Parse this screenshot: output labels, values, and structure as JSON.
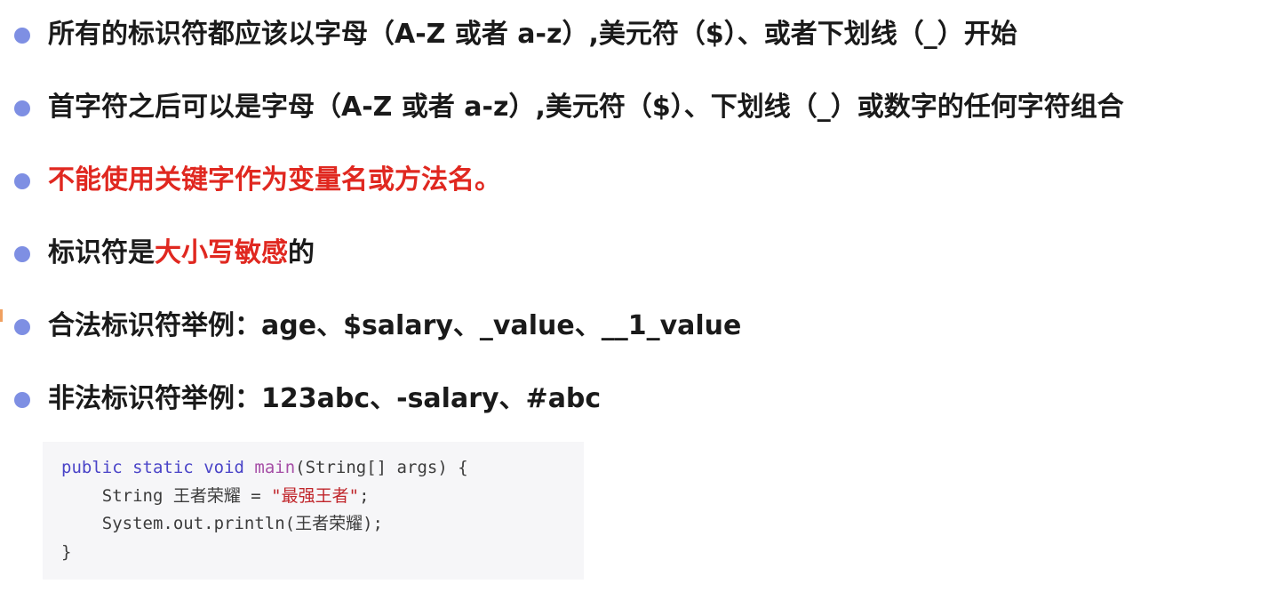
{
  "bullets": [
    {
      "text": "所有的标识符都应该以字母（A-Z 或者 a-z）,美元符（$）、或者下划线（_）开始"
    },
    {
      "text": "首字符之后可以是字母（A-Z 或者 a-z）,美元符（$）、下划线（_）或数字的任何字符组合"
    },
    {
      "text": "不能使用关键字作为变量名或方法名。"
    },
    {
      "prefix": "标识符是",
      "highlight": "大小写敏感",
      "suffix": "的"
    },
    {
      "text": "合法标识符举例：age、$salary、_value、__1_value"
    },
    {
      "text": "非法标识符举例：123abc、-salary、#abc"
    }
  ],
  "code": {
    "line1": {
      "kw1": "public",
      "kw2": "static",
      "kw3": "void",
      "fn": "main",
      "rest": "(String[] args) {"
    },
    "line2": {
      "indent": "    ",
      "type": "String",
      "var": " 王者荣耀 = ",
      "str": "\"最强王者\"",
      "end": ";"
    },
    "line3": {
      "text": "    System.out.println(王者荣耀);"
    },
    "line4": {
      "text": "}"
    }
  },
  "colors": {
    "bullet_dot": "#7e8fe3",
    "body_text": "#1a1a1a",
    "highlight_red": "#e02820",
    "code_background": "#f6f6f8",
    "code_keyword": "#4a44c8",
    "code_function": "#a64ea6",
    "code_string": "#c0262b"
  }
}
